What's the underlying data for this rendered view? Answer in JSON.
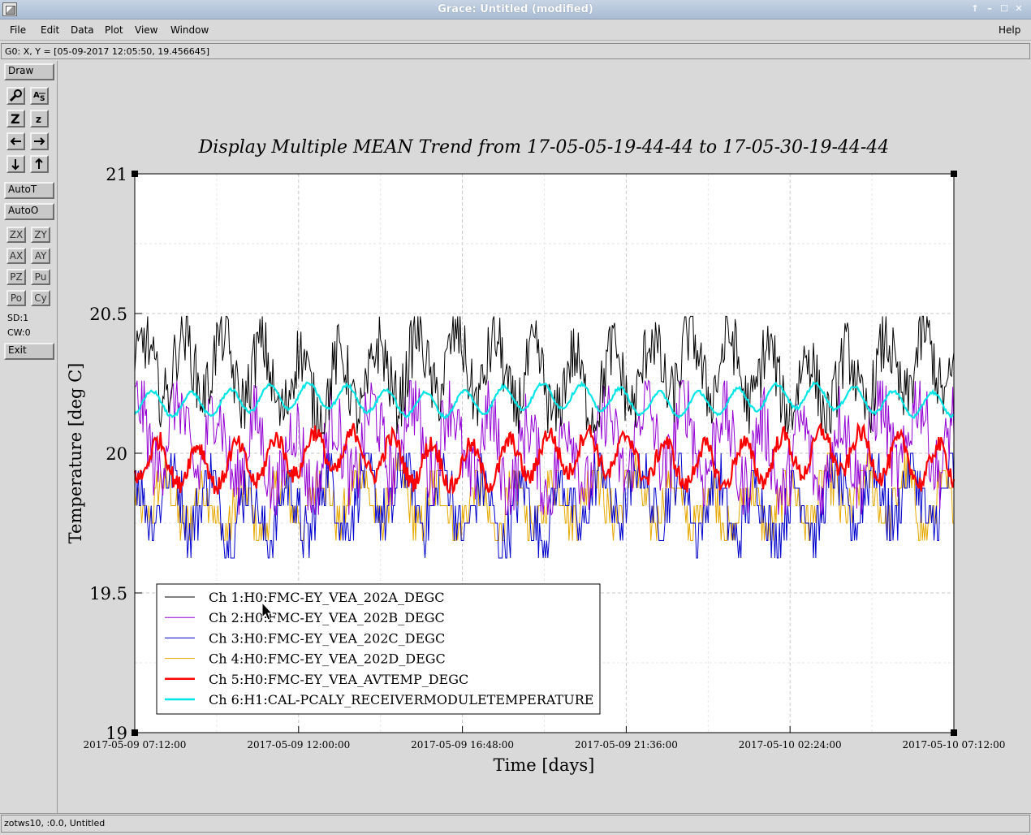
{
  "window": {
    "title": "Grace: Untitled (modified)",
    "controls": [
      "↑",
      "–",
      "☐",
      "✕"
    ]
  },
  "menubar": {
    "items": [
      {
        "label": "File",
        "key": "F"
      },
      {
        "label": "Edit",
        "key": "E"
      },
      {
        "label": "Data",
        "key": "D"
      },
      {
        "label": "Plot",
        "key": "P"
      },
      {
        "label": "View",
        "key": "V"
      },
      {
        "label": "Window",
        "key": "W"
      }
    ],
    "help": "Help"
  },
  "locator": "G0: X, Y = [05-09-2017 12:05:50, 19.456645]",
  "toolbox": {
    "draw": "Draw",
    "autot": "AutoT",
    "autoo": "AutoO",
    "zx": "ZX",
    "zy": "ZY",
    "ax": "AX",
    "ay": "AY",
    "pz": "PZ",
    "pu": "Pu",
    "po": "Po",
    "cy": "Cy",
    "sd": "SD:1",
    "cw": "CW:0",
    "exit": "Exit"
  },
  "status": "zotws10, :0.0, Untitled",
  "chart_data": {
    "type": "line",
    "title": "Display Multiple MEAN Trend from 17-05-05-19-44-44 to 17-05-30-19-44-44",
    "xlabel": "Time [days]",
    "ylabel": "Temperature [deg C]",
    "ylim": [
      19,
      21
    ],
    "xlim": [
      "2017-05-09 07:12:00",
      "2017-05-10 07:12:00"
    ],
    "x_ticks": [
      "2017-05-09 07:12:00",
      "2017-05-09 12:00:00",
      "2017-05-09 16:48:00",
      "2017-05-09 21:36:00",
      "2017-05-10 02:24:00",
      "2017-05-10 07:12:00"
    ],
    "y_ticks": [
      "19",
      "19.5",
      "20",
      "20.5",
      "21"
    ],
    "grid": true,
    "legend_position": "bottom-left",
    "series": [
      {
        "name": "Ch 1:H0:FMC-EY_VEA_202A_DEGC",
        "color": "#000000",
        "approx_mean": 20.28,
        "approx_min": 20.05,
        "approx_max": 20.47
      },
      {
        "name": "Ch 2:H0:FMC-EY_VEA_202B_DEGC",
        "color": "#9400d3",
        "approx_mean": 20.02,
        "approx_min": 19.8,
        "approx_max": 20.28
      },
      {
        "name": "Ch 3:H0:FMC-EY_VEA_202C_DEGC",
        "color": "#0000cc",
        "approx_mean": 19.82,
        "approx_min": 19.63,
        "approx_max": 20.0
      },
      {
        "name": "Ch 4:H0:FMC-EY_VEA_202D_DEGC",
        "color": "#e6a800",
        "approx_mean": 19.82,
        "approx_min": 19.63,
        "approx_max": 19.93
      },
      {
        "name": "Ch 5:H0:FMC-EY_VEA_AVTEMP_DEGC",
        "color": "#ff0000",
        "approx_mean": 19.98,
        "approx_min": 19.85,
        "approx_max": 20.12
      },
      {
        "name": "Ch 6:H1:CAL-PCALY_RECEIVERMODULETEMPERATURE",
        "color": "#00e5e5",
        "approx_mean": 20.19,
        "approx_min": 20.12,
        "approx_max": 20.28
      }
    ]
  }
}
